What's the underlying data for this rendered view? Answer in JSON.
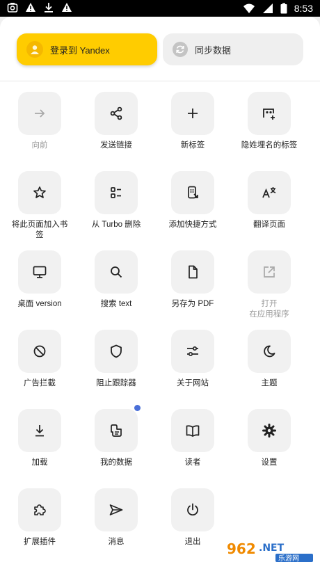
{
  "status_bar": {
    "time": "8:53",
    "left_icons": [
      "photo-icon",
      "warning-icon",
      "download-icon",
      "warning-icon"
    ],
    "right_icons": [
      "wifi-icon",
      "signal-icon",
      "battery-icon"
    ]
  },
  "header": {
    "login_label": "登录到 Yandex",
    "sync_label": "同步数据"
  },
  "menu": {
    "items": [
      {
        "label": "向前",
        "icon": "forward-arrow-icon",
        "enabled": false
      },
      {
        "label": "发送链接",
        "icon": "share-icon",
        "enabled": true
      },
      {
        "label": "新标签",
        "icon": "plus-icon",
        "enabled": true
      },
      {
        "label": "隐姓埋名的标签",
        "icon": "incognito-tab-icon",
        "enabled": true
      },
      {
        "label": "将此页面加入书\n签",
        "icon": "star-icon",
        "enabled": true
      },
      {
        "label": "从 Turbo 删除",
        "icon": "turbo-icon",
        "enabled": true
      },
      {
        "label": "添加快捷方式",
        "icon": "shortcut-icon",
        "enabled": true
      },
      {
        "label": "翻译页面",
        "icon": "translate-icon",
        "enabled": true
      },
      {
        "label": "桌面 version",
        "icon": "desktop-icon",
        "enabled": true
      },
      {
        "label": "搜索 text",
        "icon": "search-icon",
        "enabled": true
      },
      {
        "label": "另存为 PDF",
        "icon": "file-icon",
        "enabled": true
      },
      {
        "label": "打开\n在应用程序",
        "icon": "open-external-icon",
        "enabled": false
      },
      {
        "label": "广告拦截",
        "icon": "block-icon",
        "enabled": true
      },
      {
        "label": "阻止跟踪器",
        "icon": "shield-icon",
        "enabled": true
      },
      {
        "label": "关于网站",
        "icon": "sliders-icon",
        "enabled": true
      },
      {
        "label": "主题",
        "icon": "moon-icon",
        "enabled": true
      },
      {
        "label": "加载",
        "icon": "download-icon",
        "enabled": true
      },
      {
        "label": "我的数据",
        "icon": "my-data-icon",
        "enabled": true,
        "badge": true
      },
      {
        "label": "读者",
        "icon": "book-icon",
        "enabled": true
      },
      {
        "label": "设置",
        "icon": "gear-icon",
        "enabled": true
      },
      {
        "label": "扩展插件",
        "icon": "puzzle-icon",
        "enabled": true
      },
      {
        "label": "消息",
        "icon": "send-icon",
        "enabled": true
      },
      {
        "label": "退出",
        "icon": "power-icon",
        "enabled": true
      }
    ]
  },
  "colors": {
    "accent_yellow": "#ffcc00",
    "badge_blue": "#4a6fd8",
    "tile_bg": "#f1f1f1"
  },
  "watermark": {
    "text": "962.NET 乐游网"
  }
}
